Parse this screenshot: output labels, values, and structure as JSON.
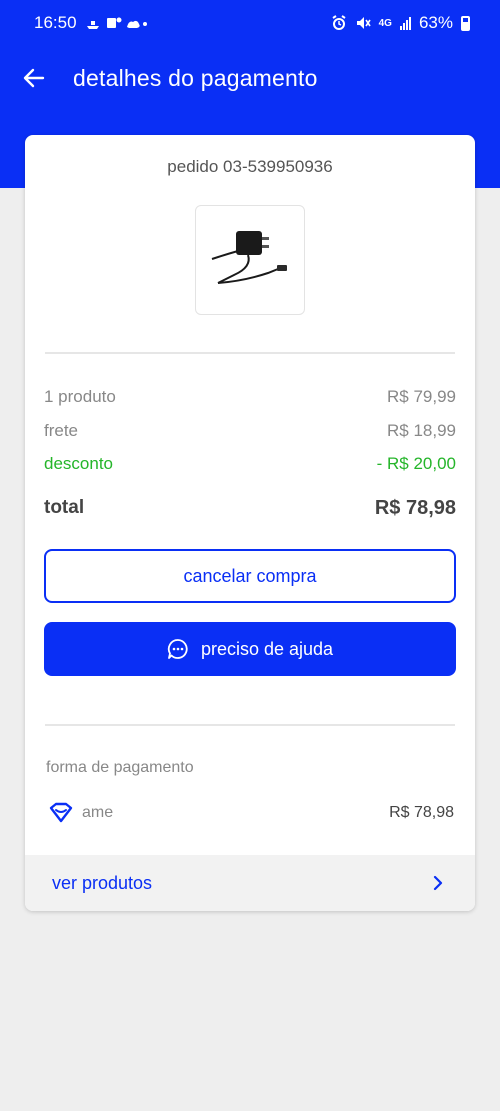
{
  "status_bar": {
    "time": "16:50",
    "network": "4G",
    "battery": "63%"
  },
  "header": {
    "title": "detalhes do pagamento",
    "back_icon": "arrow-left-icon"
  },
  "order": {
    "id_text": "pedido 03-539950936",
    "product_image": "usb-c-charger-with-cable"
  },
  "summary": {
    "products_label": "1 produto",
    "products_value": "R$ 79,99",
    "shipping_label": "frete",
    "shipping_value": "R$ 18,99",
    "discount_label": "desconto",
    "discount_value": "- R$ 20,00",
    "total_label": "total",
    "total_value": "R$ 78,98"
  },
  "actions": {
    "cancel_label": "cancelar compra",
    "help_label": "preciso de ajuda",
    "help_icon": "chat-bubble-icon"
  },
  "payment": {
    "section_label": "forma de pagamento",
    "method_icon": "ame-heart-icon",
    "method_name": "ame",
    "amount": "R$ 78,98"
  },
  "footer": {
    "link_label": "ver produtos",
    "chevron_icon": "chevron-right-icon"
  },
  "colors": {
    "brand_blue": "#0a2ff5",
    "discount_green": "#25b52a",
    "background": "#eeeeee"
  }
}
